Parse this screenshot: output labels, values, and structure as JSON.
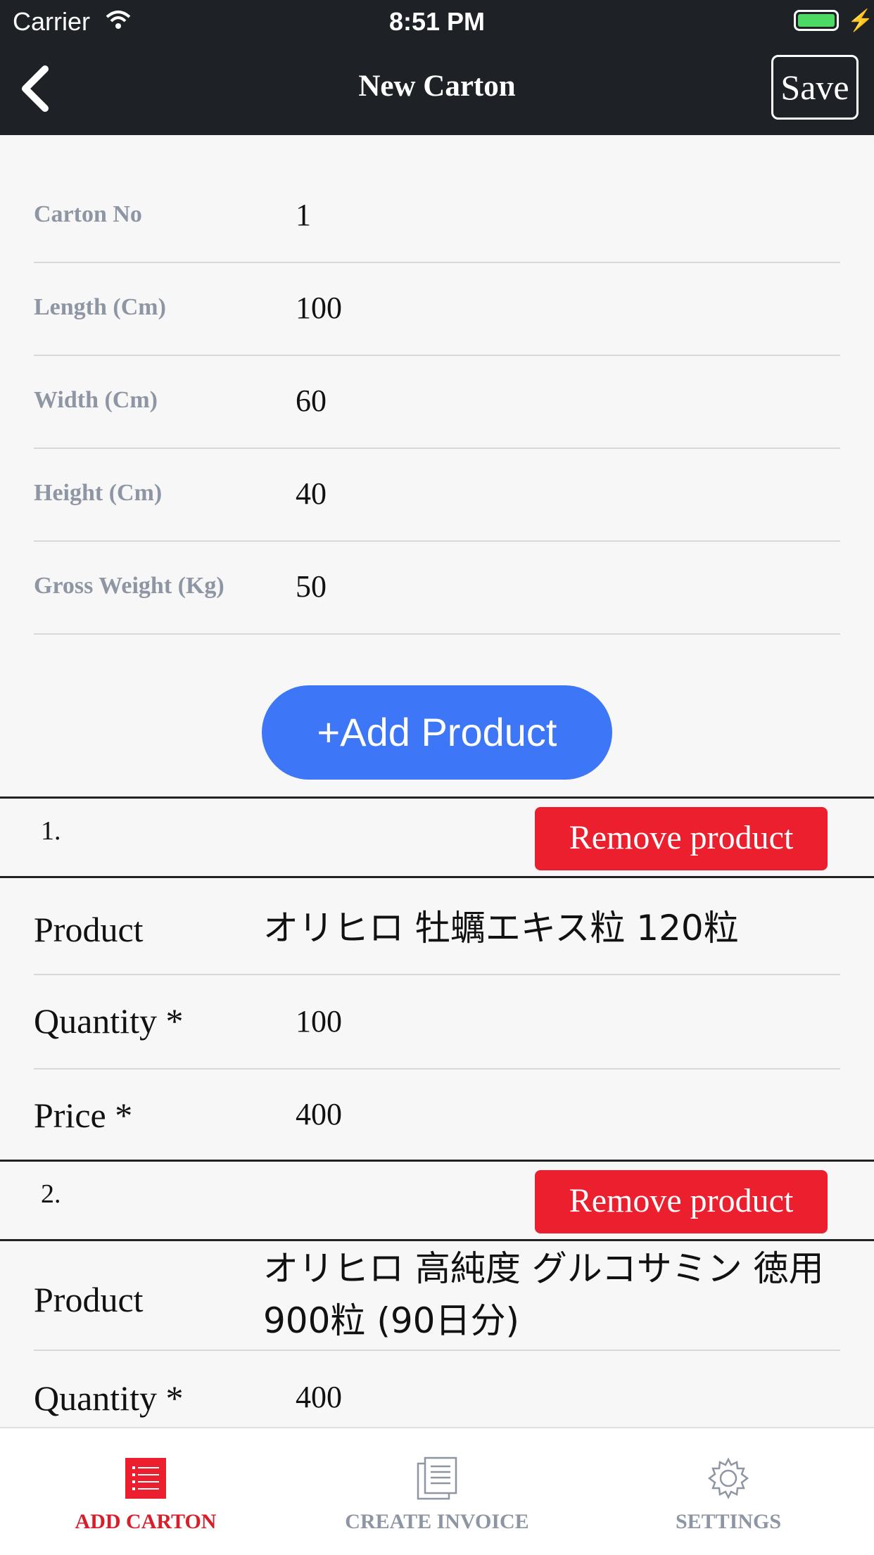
{
  "status_bar": {
    "carrier": "Carrier",
    "time": "8:51 PM"
  },
  "nav": {
    "title": "New Carton",
    "save_label": "Save"
  },
  "carton_fields": [
    {
      "label": "Carton No",
      "value": "1"
    },
    {
      "label": "Length (Cm)",
      "value": "100"
    },
    {
      "label": "Width (Cm)",
      "value": "60"
    },
    {
      "label": "Height (Cm)",
      "value": "40"
    },
    {
      "label": "Gross Weight (Kg)",
      "value": "50"
    }
  ],
  "add_product_label": "+Add Product",
  "products": [
    {
      "number": "1.",
      "remove_label": "Remove product",
      "product_label": "Product",
      "product_name": "オリヒロ 牡蠣エキス粒 120粒",
      "quantity_label": "Quantity *",
      "quantity": "100",
      "price_label": "Price *",
      "price": "400"
    },
    {
      "number": "2.",
      "remove_label": "Remove product",
      "product_label": "Product",
      "product_name": "オリヒロ 高純度 グルコサミン 徳用 900粒 (90日分)",
      "quantity_label": "Quantity *",
      "quantity": "400"
    }
  ],
  "tabs": [
    {
      "label": "ADD CARTON",
      "icon": "list-icon",
      "active": true
    },
    {
      "label": "CREATE INVOICE",
      "icon": "document-icon",
      "active": false
    },
    {
      "label": "SETTINGS",
      "icon": "gear-icon",
      "active": false
    }
  ],
  "colors": {
    "nav_bg": "#1e2126",
    "accent_blue": "#3d76f6",
    "remove_red": "#ec1f2e",
    "active_tab": "#d91e2b",
    "label_gray": "#8e96a3"
  }
}
